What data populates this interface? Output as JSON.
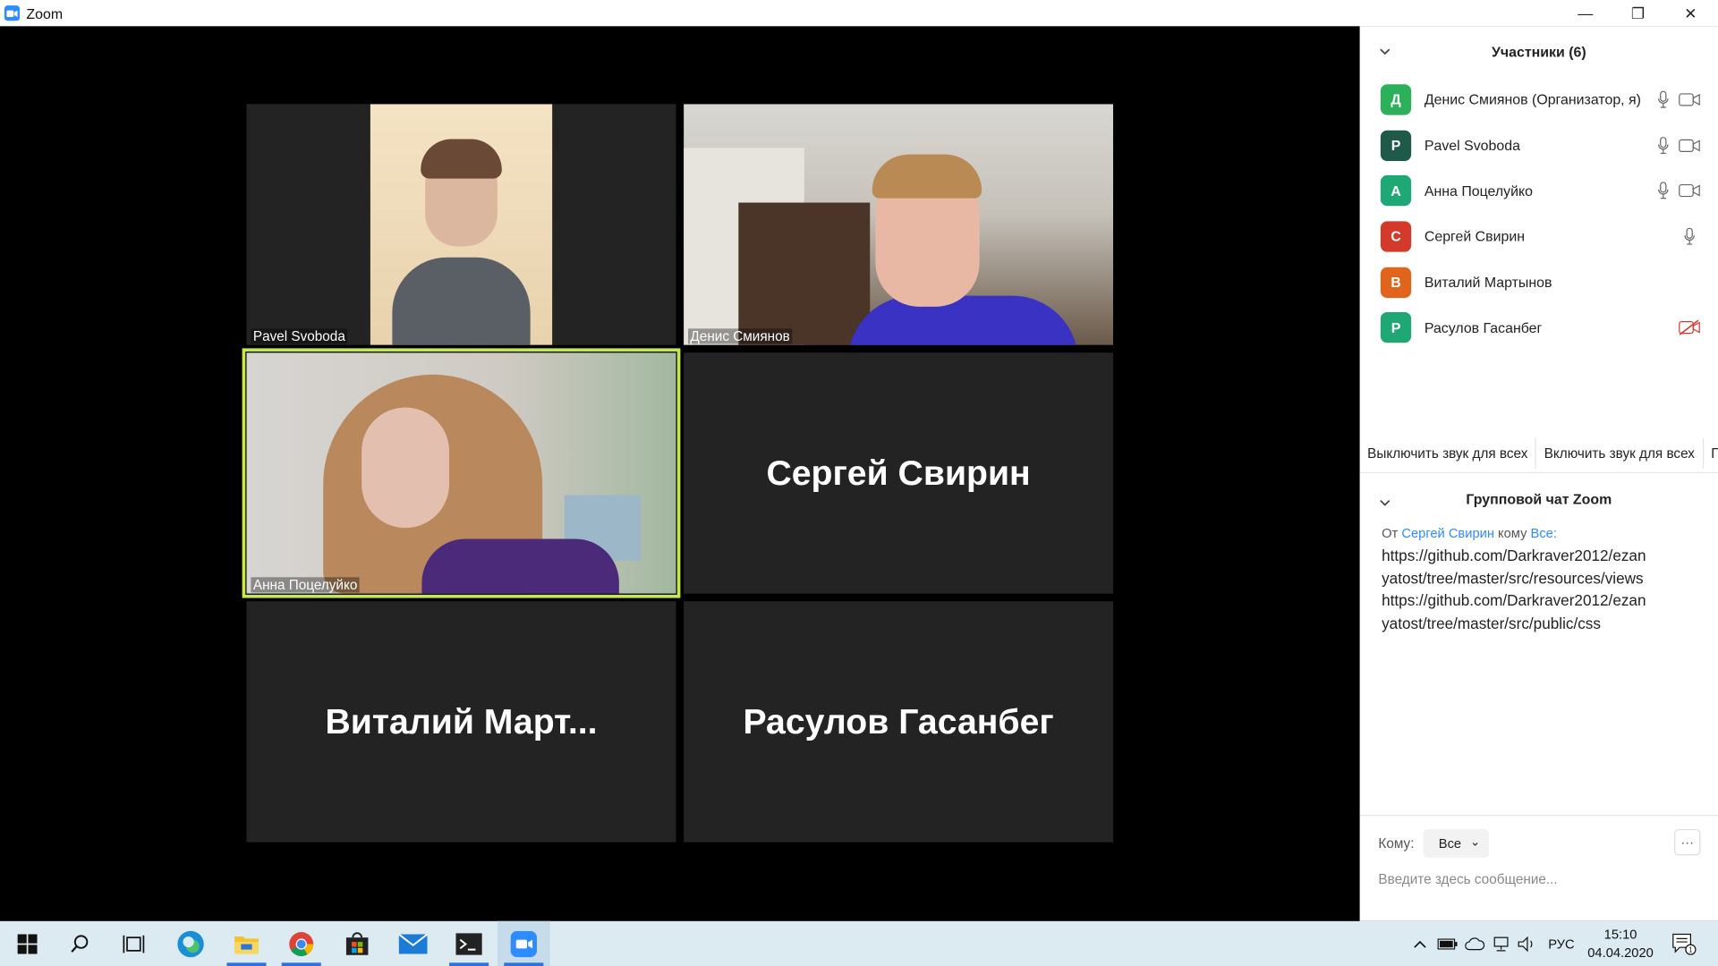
{
  "window": {
    "title": "Zoom",
    "minimize": "—",
    "maximize": "❐",
    "close": "✕"
  },
  "video": {
    "tiles": [
      {
        "name": "Pavel Svoboda"
      },
      {
        "name": "Денис Смиянов"
      },
      {
        "name": "Анна Поцелуйко"
      },
      {
        "big_name": "Сергей Свирин"
      },
      {
        "big_name": "Виталий  Март..."
      },
      {
        "big_name": "Расулов Гасанбег"
      }
    ]
  },
  "participants": {
    "title": "Участники (6)",
    "items": [
      {
        "initial": "Д",
        "name": "Денис Смиянов (Организатор, я)",
        "color": "#2DB05A",
        "mic": "on",
        "video": "on"
      },
      {
        "initial": "P",
        "name": "Pavel Svoboda",
        "color": "#1F5A48",
        "mic": "on",
        "video": "on"
      },
      {
        "initial": "А",
        "name": "Анна Поцелуйко",
        "color": "#1FA876",
        "mic": "on",
        "video": "on"
      },
      {
        "initial": "С",
        "name": "Сергей Свирин",
        "color": "#D33A2C",
        "mic": "on",
        "video": "none"
      },
      {
        "initial": "В",
        "name": "Виталий Мартынов",
        "color": "#E0641C",
        "mic": "none",
        "video": "none"
      },
      {
        "initial": "Р",
        "name": "Расулов Гасанбег",
        "color": "#1FA876",
        "mic": "none",
        "video": "off"
      }
    ],
    "buttons": [
      "Выключить звук для всех",
      "Включить звук для всех",
      "П"
    ]
  },
  "chat": {
    "title": "Групповой чат Zoom",
    "from_prefix": "От",
    "from_name": "Сергей Свирин",
    "to_word": "кому",
    "to_target": "Все:",
    "message_lines": [
      "https://github.com/Darkraver2012/ezan",
      "yatost/tree/master/src/resources/views",
      "https://github.com/Darkraver2012/ezan",
      "yatost/tree/master/src/public/css"
    ],
    "to_label": "Кому:",
    "to_value": "Все",
    "more": "···",
    "input_placeholder": "Введите здесь сообщение..."
  },
  "taskbar": {
    "apps": [
      "start-icon",
      "search-icon",
      "task-view-icon",
      "edge-icon",
      "file-explorer-icon",
      "chrome-icon",
      "store-icon",
      "mail-icon",
      "terminal-icon",
      "zoom-icon"
    ],
    "language": "РУС",
    "time": "15:10",
    "date": "04.04.2020",
    "notifications": "1"
  },
  "colors": {
    "accent": "#2D8CFF",
    "speaking_border": "#C5E84E",
    "taskbar": "#DCEBF1",
    "tile": "#232323"
  }
}
